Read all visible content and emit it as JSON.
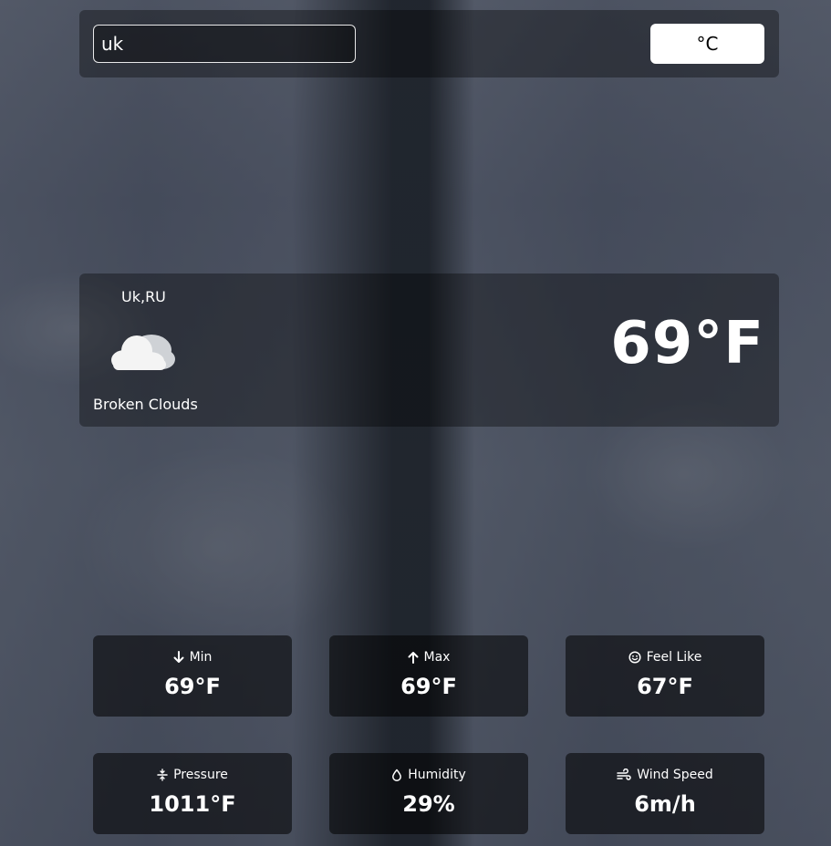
{
  "search": {
    "value": "uk"
  },
  "unit_toggle": {
    "label": "°C"
  },
  "current": {
    "location": "Uk,RU",
    "icon": "broken-clouds-icon",
    "description": "Broken Clouds",
    "temperature": "69°F"
  },
  "stats": [
    {
      "icon": "arrow-down-icon",
      "label": "Min",
      "value": "69°F"
    },
    {
      "icon": "arrow-up-icon",
      "label": "Max",
      "value": "69°F"
    },
    {
      "icon": "smile-icon",
      "label": "Feel Like",
      "value": "67°F"
    },
    {
      "icon": "pressure-icon",
      "label": "Pressure",
      "value": "1011°F"
    },
    {
      "icon": "droplet-icon",
      "label": "Humidity",
      "value": "29%"
    },
    {
      "icon": "wind-icon",
      "label": "Wind Speed",
      "value": "6m/h"
    }
  ]
}
